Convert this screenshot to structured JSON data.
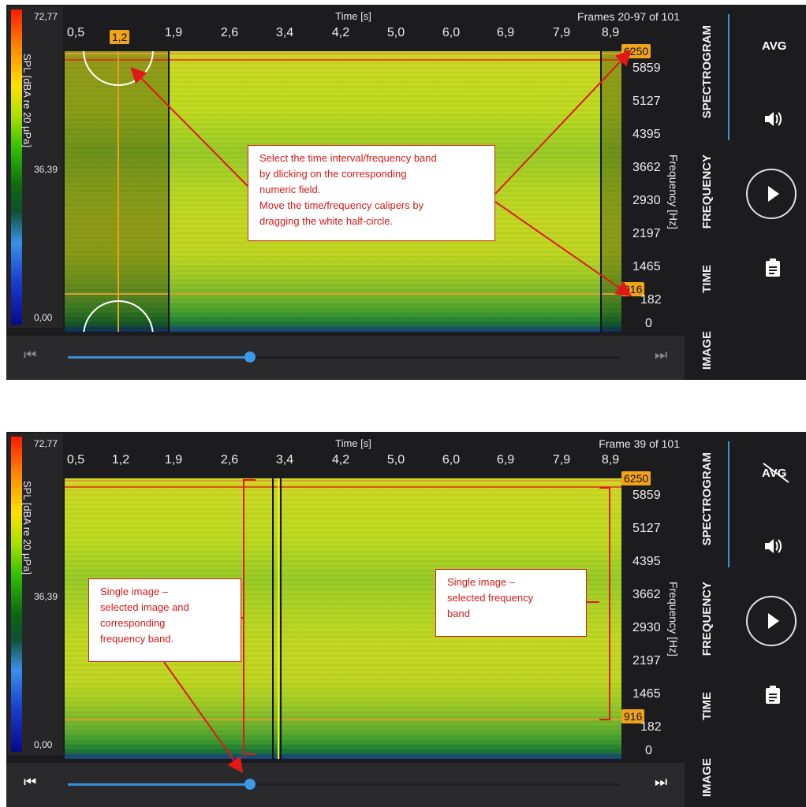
{
  "colors": {
    "accent": "#3b8fd8",
    "badge": "#f2a31c",
    "annotation": "#d01a1a",
    "panel_bg": "#1c1c1e"
  },
  "panel1": {
    "legend": {
      "max": "72,77",
      "mid": "36,39",
      "min": "0,00",
      "label": "SPL [dBA re 20 µPa]"
    },
    "time_header": "Time [s]",
    "frames_label": "Frames 20-97 of 101",
    "time_ticks": [
      "0,5",
      "1,9",
      "2,6",
      "3,4",
      "4,2",
      "5,0",
      "6,0",
      "6,9",
      "7,9",
      "8,9"
    ],
    "time_selected": "1,2",
    "freq_ticks": [
      "5859",
      "5127",
      "4395",
      "3662",
      "2930",
      "2197",
      "1465",
      "182",
      "0"
    ],
    "freq_top": "6250",
    "freq_bottom": "916",
    "freq_label": "Frequency [Hz]",
    "tabs": [
      "SPECTROGRAM",
      "FREQUENCY",
      "TIME",
      "IMAGE"
    ],
    "avg_label": "AVG",
    "icons": [
      "speaker-icon",
      "play-icon",
      "clipboard-icon"
    ],
    "slider_fraction": 0.33,
    "annotation": [
      "Select the time interval/frequency band",
      "by dlicking on the corresponding",
      "numeric field.",
      "Move the time/frequency calipers by",
      "dragging the white half-circle."
    ]
  },
  "panel2": {
    "legend": {
      "max": "72,77",
      "mid": "36,39",
      "min": "0,00",
      "label": "SPL [dBA re 20 µPa]"
    },
    "time_header": "Time [s]",
    "frames_label": "Frame 39 of 101",
    "time_ticks": [
      "0,5",
      "1,2",
      "1,9",
      "2,6",
      "3,4",
      "4,2",
      "5,0",
      "6,0",
      "6,9",
      "7,9",
      "8,9"
    ],
    "freq_ticks": [
      "5859",
      "5127",
      "4395",
      "3662",
      "2930",
      "2197",
      "1465",
      "182",
      "0"
    ],
    "freq_top": "6250",
    "freq_bottom": "916",
    "freq_label": "Frequency [Hz]",
    "tabs": [
      "SPECTROGRAM",
      "FREQUENCY",
      "TIME",
      "IMAGE"
    ],
    "avg_label": "AVG",
    "icons": [
      "speaker-icon",
      "play-icon",
      "clipboard-icon"
    ],
    "slider_fraction": 0.33,
    "annotation_left": [
      "Single image –",
      "selected image and",
      "corresponding",
      "frequency band."
    ],
    "annotation_right": [
      "Single image –",
      "selected frequency",
      "band"
    ]
  }
}
